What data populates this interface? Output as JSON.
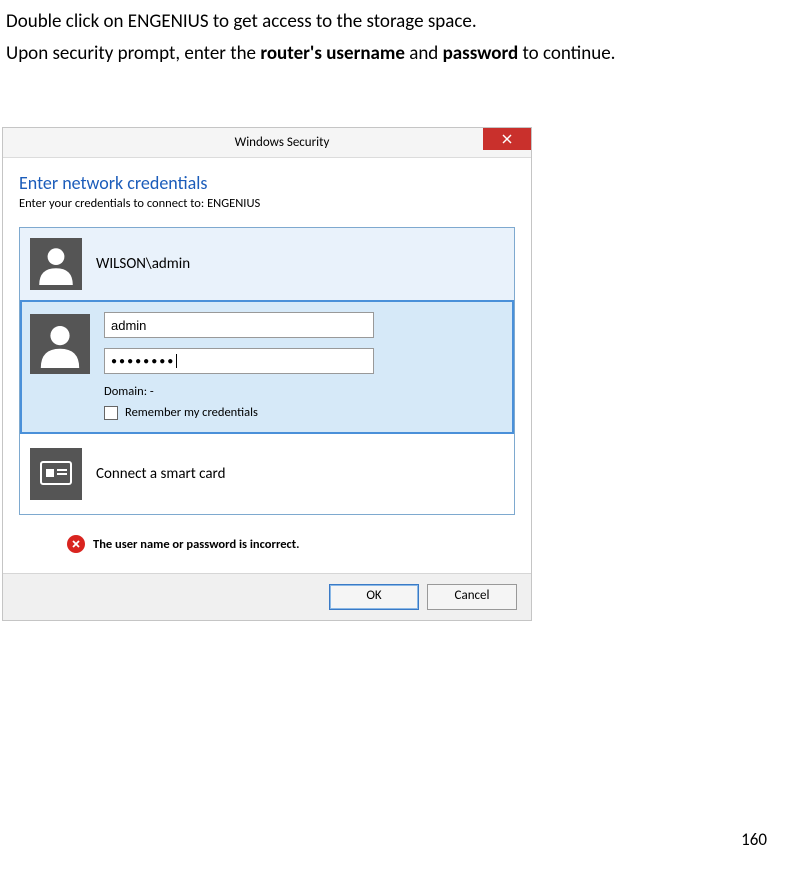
{
  "doc": {
    "line1": "Double click on ENGENIUS to get access to the storage space.",
    "line2_pre": "Upon security prompt, enter the ",
    "line2_b1": "router's username",
    "line2_mid": " and ",
    "line2_b2": "password",
    "line2_post": " to continue.",
    "page_number": "160"
  },
  "dialog": {
    "title": "Windows Security",
    "heading": "Enter network credentials",
    "subtext": "Enter your credentials to connect to: ENGENIUS",
    "existing_user": "WILSON\\admin",
    "username_value": "admin",
    "password_masked": "●●●●●●●●",
    "domain_label": "Domain: -",
    "remember_label": "Remember my credentials",
    "smartcard_label": "Connect a smart card",
    "error_text": "The user name or password is incorrect.",
    "ok_label": "OK",
    "cancel_label": "Cancel"
  }
}
